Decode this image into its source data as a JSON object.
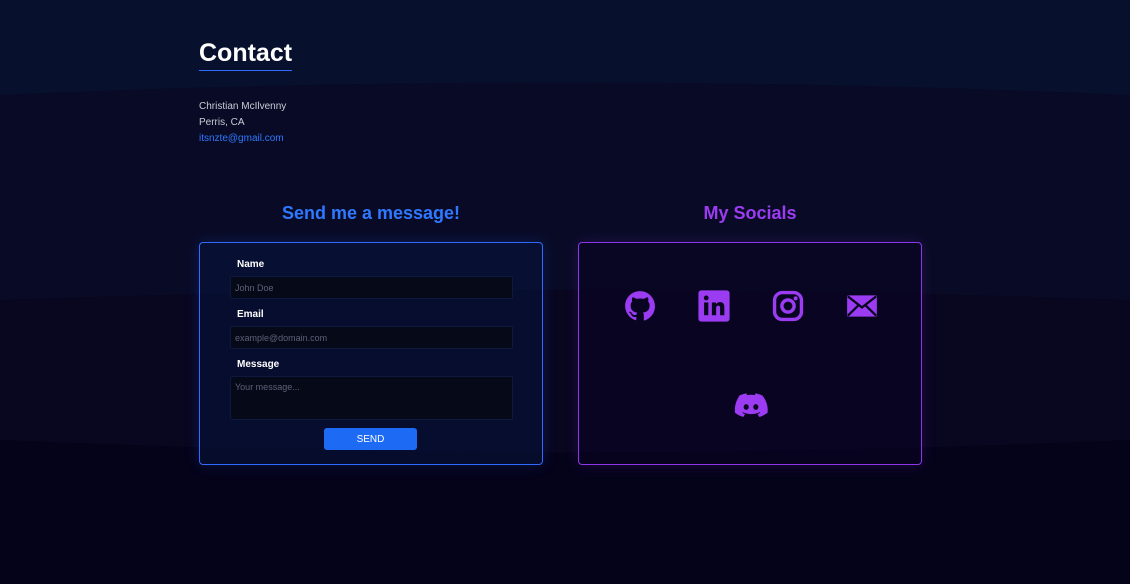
{
  "header": {
    "title": "Contact"
  },
  "contact_info": {
    "name": "Christian McIlvenny",
    "location": "Perris, CA",
    "email": "itsnzte@gmail.com"
  },
  "message_section": {
    "heading": "Send me a message!",
    "name_label": "Name",
    "name_placeholder": "John Doe",
    "email_label": "Email",
    "email_placeholder": "example@domain.com",
    "message_label": "Message",
    "message_placeholder": "Your message...",
    "send_label": "SEND"
  },
  "socials_section": {
    "heading": "My Socials",
    "icons": [
      "github-icon",
      "linkedin-icon",
      "instagram-icon",
      "mail-icon",
      "discord-icon"
    ]
  },
  "colors": {
    "background": "#06041a",
    "accent_blue": "#2f78ff",
    "accent_purple": "#9b3cf2",
    "button": "#1d6bf5"
  }
}
